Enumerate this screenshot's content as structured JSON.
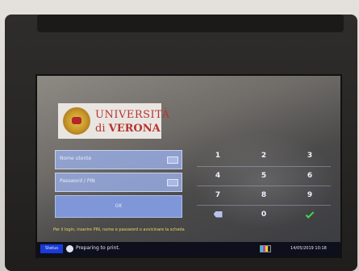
{
  "logo": {
    "line1": "UNIVERSITÀ",
    "line2_prefix": "di ",
    "line2_bold": "VERONA"
  },
  "login": {
    "username_label": "Nome utente",
    "password_label": "Password / PIN",
    "ok_label": "OK",
    "hint": "Per il login, inserire PIN, nome e password o avvicinare la scheda"
  },
  "keypad": {
    "keys": [
      "1",
      "2",
      "3",
      "4",
      "5",
      "6",
      "7",
      "8",
      "9",
      "0"
    ]
  },
  "status_bar": {
    "status_button": "Status",
    "message": "Preparing to print.",
    "datetime": "14/05/2019  10:18"
  },
  "icons": {
    "keyboard": "keyboard-icon",
    "backspace": "backspace-icon",
    "confirm": "checkmark-icon",
    "status": "status-icon",
    "toner": "toner-icon",
    "seal": "university-seal-icon"
  },
  "colors": {
    "field": "#96aae1",
    "ok_button": "#7f97d8",
    "hint_text": "#e7d95a",
    "status_button": "#1a3bd6",
    "confirm": "#48d651",
    "logo_text": "#b8332f"
  }
}
